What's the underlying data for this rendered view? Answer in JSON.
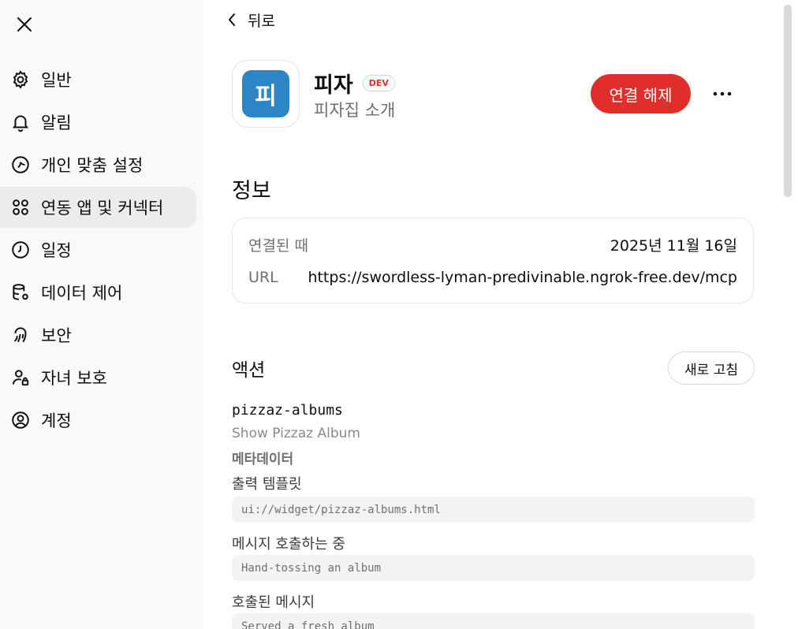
{
  "sidebar": {
    "items": [
      {
        "label": "일반",
        "icon": "gear-icon",
        "active": false
      },
      {
        "label": "알림",
        "icon": "bell-icon",
        "active": false
      },
      {
        "label": "개인 맞춤 설정",
        "icon": "personalize-icon",
        "active": false
      },
      {
        "label": "연동 앱 및 커넥터",
        "icon": "apps-icon",
        "active": true
      },
      {
        "label": "일정",
        "icon": "clock-icon",
        "active": false
      },
      {
        "label": "데이터 제어",
        "icon": "database-gear-icon",
        "active": false
      },
      {
        "label": "보안",
        "icon": "fingerprint-icon",
        "active": false
      },
      {
        "label": "자녀 보호",
        "icon": "person-lock-icon",
        "active": false
      },
      {
        "label": "계정",
        "icon": "account-icon",
        "active": false
      }
    ]
  },
  "header": {
    "back_label": "뒤로"
  },
  "app": {
    "logo_text": "피",
    "name": "피자",
    "badge": "DEV",
    "subtitle": "피자집 소개",
    "disconnect_label": "연결 해제",
    "more_label": "•••"
  },
  "info": {
    "title": "정보",
    "rows": [
      {
        "label": "연결된 때",
        "value": "2025년 11월 16일"
      },
      {
        "label": "URL",
        "value": "https://swordless-lyman-predivinable.ngrok-free.dev/mcp"
      }
    ]
  },
  "actions": {
    "title": "액션",
    "refresh_label": "새로 고침",
    "tool": {
      "name": "pizzaz-albums",
      "description": "Show Pizzaz Album",
      "metadata_label": "메타데이터",
      "fields": [
        {
          "label": "출력 템플릿",
          "value": "ui://widget/pizzaz-albums.html"
        },
        {
          "label": "메시지 호출하는 중",
          "value": "Hand-tossing an album"
        },
        {
          "label": "호출된 메시지",
          "value": "Served a fresh album"
        }
      ]
    }
  },
  "colors": {
    "accent_red": "#e02e2a",
    "app_logo_blue": "#2c86c5",
    "sidebar_bg": "#f9f9f9",
    "active_bg": "#ececec"
  }
}
